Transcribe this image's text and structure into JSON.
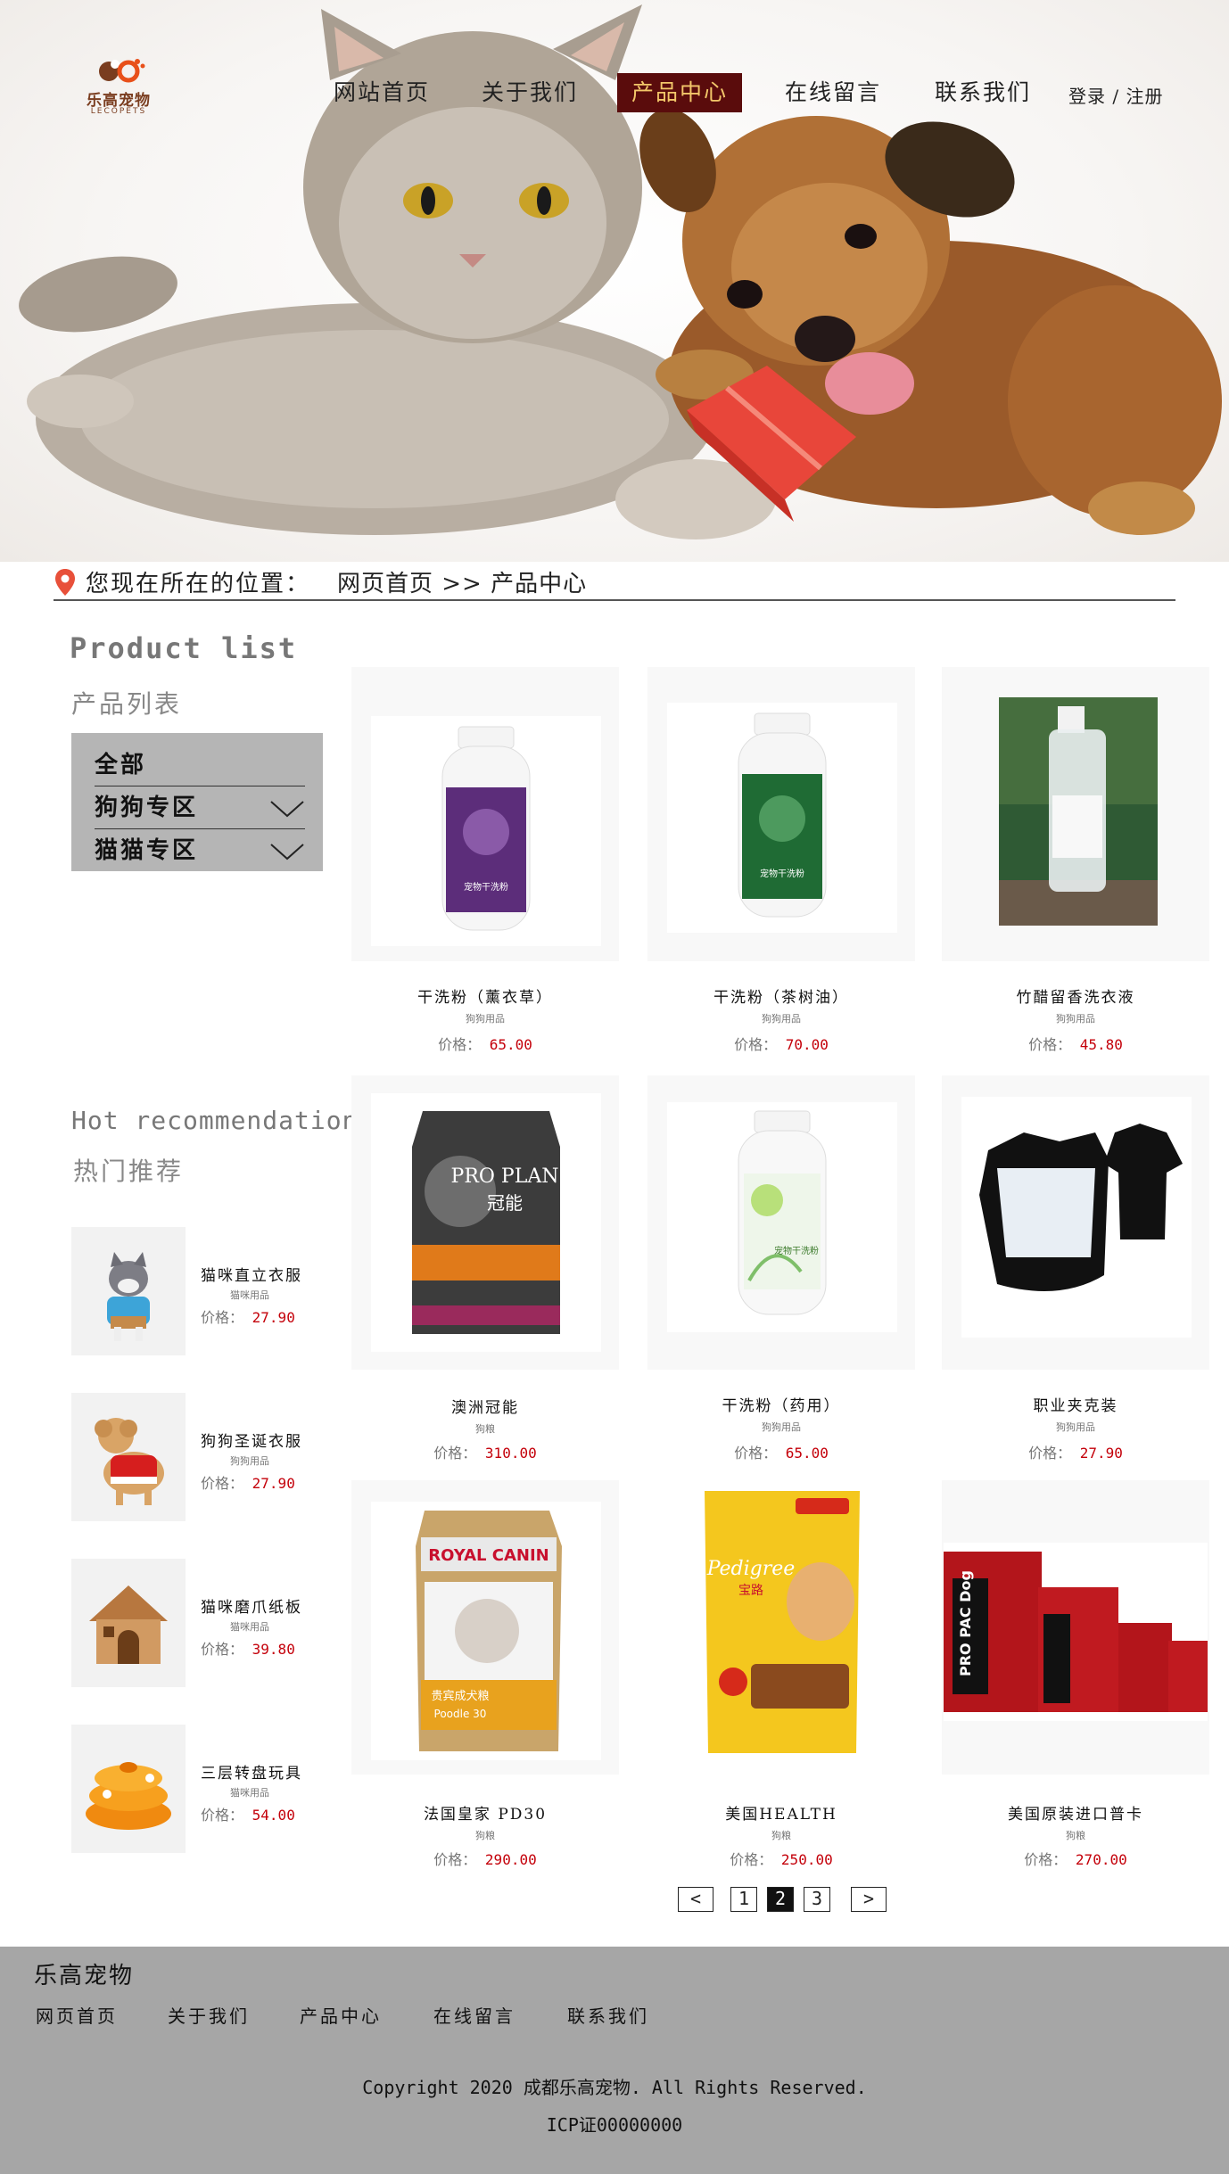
{
  "brand": {
    "logo_cn": "乐高宠物",
    "logo_en": "LECOPETS"
  },
  "nav": {
    "items": [
      "网站首页",
      "关于我们",
      "产品中心",
      "在线留言",
      "联系我们"
    ],
    "active": "产品中心",
    "login": "登录 / 注册"
  },
  "breadcrumb": {
    "label": "您现在所在的位置：",
    "path": "网页首页 >> 产品中心"
  },
  "sidebar": {
    "title_en": "Product list",
    "title_cn": "产品列表",
    "categories": [
      {
        "label": "全部"
      },
      {
        "label": "狗狗专区"
      },
      {
        "label": "猫猫专区"
      }
    ],
    "hot_en": "Hot recommendation",
    "hot_cn": "热门推荐",
    "hot_items": [
      {
        "name": "猫咪直立衣服",
        "category": "猫咪用品",
        "price_label": "价格：",
        "price": "27.90"
      },
      {
        "name": "狗狗圣诞衣服",
        "category": "狗狗用品",
        "price_label": "价格：",
        "price": "27.90"
      },
      {
        "name": "猫咪磨爪纸板",
        "category": "猫咪用品",
        "price_label": "价格：",
        "price": "39.80"
      },
      {
        "name": "三层转盘玩具",
        "category": "猫咪用品",
        "price_label": "价格：",
        "price": "54.00"
      }
    ]
  },
  "products": [
    {
      "name": "干洗粉（薰衣草）",
      "category": "狗狗用品",
      "price_label": "价格：",
      "price": "65.00"
    },
    {
      "name": "干洗粉（茶树油）",
      "category": "狗狗用品",
      "price_label": "价格：",
      "price": "70.00"
    },
    {
      "name": "竹醋留香洗衣液",
      "category": "狗狗用品",
      "price_label": "价格：",
      "price": "45.80"
    },
    {
      "name": "澳洲冠能",
      "category": "狗粮",
      "price_label": "价格：",
      "price": "310.00"
    },
    {
      "name": "干洗粉（药用）",
      "category": "狗狗用品",
      "price_label": "价格：",
      "price": "65.00"
    },
    {
      "name": "职业夹克装",
      "category": "狗狗用品",
      "price_label": "价格：",
      "price": "27.90"
    },
    {
      "name": "法国皇家 PD30",
      "category": "狗粮",
      "price_label": "价格：",
      "price": "290.00"
    },
    {
      "name": "美国HEALTH",
      "category": "狗粮",
      "price_label": "价格：",
      "price": "250.00"
    },
    {
      "name": "美国原装进口普卡",
      "category": "狗粮",
      "price_label": "价格：",
      "price": "270.00"
    }
  ],
  "product_labels": {
    "royal": "ROYAL CANIN",
    "royal_sub": "贵宾成犬粮",
    "royal_sub2": "Poodle 30",
    "pedigree": "Pedigree",
    "pedigree_cn": "宝路",
    "proplan": "PRO PLAN",
    "proplan_cn": "冠能",
    "propac": "PRO PAC Dog"
  },
  "pagination": {
    "prev": "<",
    "pages": [
      "1",
      "2",
      "3"
    ],
    "current": "2",
    "next": ">"
  },
  "footer": {
    "brand": "乐高宠物",
    "links": [
      "网页首页",
      "关于我们",
      "产品中心",
      "在线留言",
      "联系我们"
    ],
    "copyright": "Copyright 2020 成都乐高宠物. All Rights Reserved.",
    "icp": "ICP证00000000"
  },
  "colors": {
    "nav_active_bg": "#5a0c0c",
    "nav_active_text": "#f3c76a",
    "price": "#c4000a",
    "footer_bg": "#a6a6a6",
    "category_box": "#b5b5b5"
  }
}
